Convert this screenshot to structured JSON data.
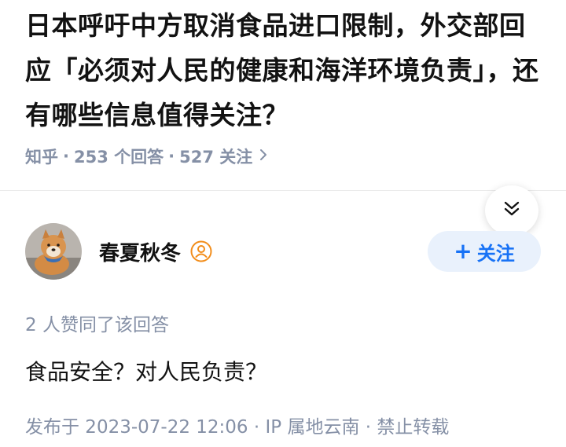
{
  "question": {
    "title": "日本呼吁中方取消食品进口限制，外交部回应「必须对人民的健康和海洋环境负责」，还有哪些信息值得关注？",
    "source": "知乎",
    "answer_count_text": "253 个回答",
    "follower_count_text": "527 关注",
    "separator": "·",
    "more_icon": "chevron-right-icon"
  },
  "collapse": {
    "icon": "double-chevron-down-icon"
  },
  "author": {
    "name": "春夏秋冬",
    "badge_icon": "user-badge-icon",
    "avatar_desc": "shiba-dog-avatar",
    "follow_label": "关注",
    "follow_plus": "+"
  },
  "answer": {
    "votes_text": "2 人赞同了该回答",
    "content": "食品安全？对人民负责？",
    "meta_text": "发布于 2023-07-22 12:06 · IP 属地云南 · 禁止转载"
  },
  "colors": {
    "title": "#121212",
    "meta_gray": "#8590a6",
    "follow_blue": "#1772f6",
    "follow_bg": "#e9f1fc",
    "badge_orange": "#f28d1a"
  }
}
